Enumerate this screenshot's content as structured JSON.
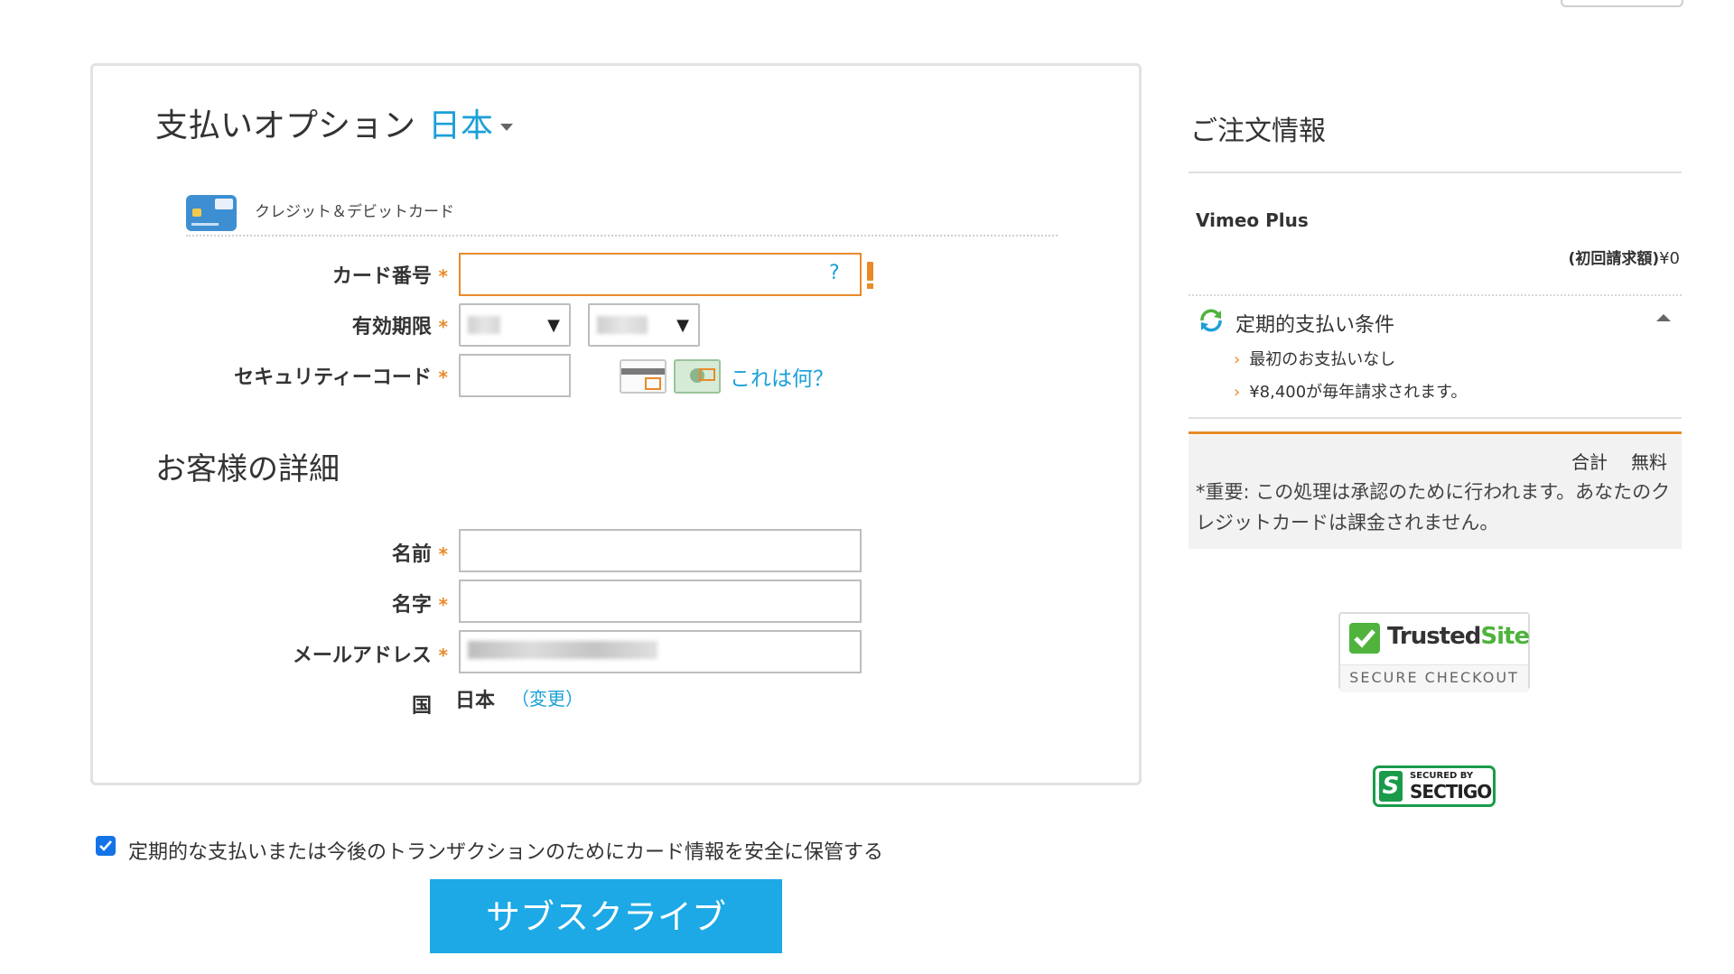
{
  "payment": {
    "title": "支払いオプション",
    "country": "日本",
    "method_label": "クレジット＆デビットカード",
    "card_number_label": "カード番号",
    "card_help": "?",
    "expiry_label": "有効期限",
    "security_label": "セキュリティーコード",
    "what_is_this": "これは何？",
    "required_mark": "*"
  },
  "customer": {
    "title": "お客様の詳細",
    "first_name_label": "名前",
    "last_name_label": "名字",
    "email_label": "メールアドレス",
    "country_label": "国",
    "country_value": "日本",
    "change_link": "（変更）"
  },
  "save_card": {
    "label": "定期的な支払いまたは今後のトランザクションのためにカード情報を安全に保管する",
    "checked": true
  },
  "subscribe_button": "サブスクライブ",
  "order": {
    "title": "ご注文情報",
    "product": "Vimeo Plus",
    "first_charge_label": "(初回請求額)",
    "first_charge_value": "¥0",
    "recurring_title": "定期的支払い条件",
    "recurring_items": [
      "最初のお支払いなし",
      "¥8,400が毎年請求されます。"
    ],
    "total_label": "合計",
    "total_value": "無料",
    "note": "*重要: この処理は承認のために行われます。あなたのクレジットカードは課金されません。"
  },
  "badges": {
    "trusted_site_word1": "Trusted",
    "trusted_site_word2": "Site",
    "trusted_site_sub": "SECURE CHECKOUT",
    "sectigo_small": "SECURED BY",
    "sectigo_big": "SECTIGO"
  },
  "colors": {
    "accent": "#1ba0d8",
    "required": "#e88a28",
    "subscribe_bg": "#1ca9e6",
    "trusted_green": "#4fb33d",
    "sectigo_green": "#1a9b4a"
  }
}
